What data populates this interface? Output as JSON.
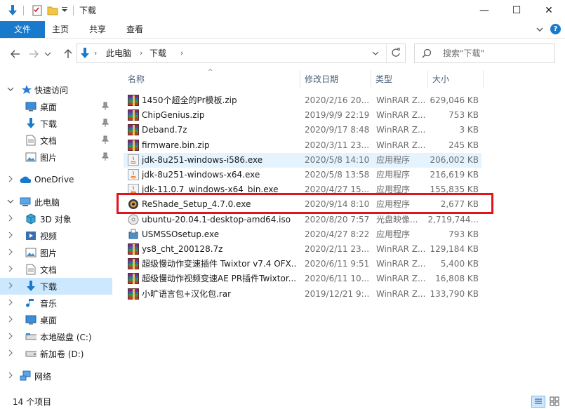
{
  "window": {
    "title": "下载",
    "controls": {
      "minimize": "—",
      "maximize": "☐",
      "close": "✕"
    }
  },
  "ribbon": {
    "tabs": [
      {
        "label": "文件",
        "active": true
      },
      {
        "label": "主页"
      },
      {
        "label": "共享"
      },
      {
        "label": "查看"
      }
    ],
    "expand_icon": "chevron-down-icon",
    "help_icon": "help-icon"
  },
  "address": {
    "segments": [
      "此电脑",
      "下载"
    ],
    "separator": "›"
  },
  "search": {
    "placeholder": "搜索\"下载\""
  },
  "nav": {
    "items": [
      {
        "label": "快速访问",
        "icon": "star-icon",
        "chevron": "⌄",
        "expanded": true
      },
      {
        "label": "桌面",
        "icon": "desktop-icon",
        "pinned": true
      },
      {
        "label": "下载",
        "icon": "download-arrow-icon",
        "pinned": true
      },
      {
        "label": "文档",
        "icon": "document-icon",
        "pinned": true
      },
      {
        "label": "图片",
        "icon": "picture-icon",
        "pinned": true
      },
      {
        "label": "OneDrive",
        "icon": "cloud-icon",
        "chevron": "›"
      },
      {
        "label": "此电脑",
        "icon": "pc-icon",
        "chevron": "⌄",
        "expanded": true
      },
      {
        "label": "3D 对象",
        "icon": "cube-icon",
        "chevron": "›"
      },
      {
        "label": "视频",
        "icon": "video-icon",
        "chevron": "›"
      },
      {
        "label": "图片",
        "icon": "picture-icon",
        "chevron": "›"
      },
      {
        "label": "文档",
        "icon": "document-icon",
        "chevron": "›"
      },
      {
        "label": "下载",
        "icon": "download-arrow-icon",
        "chevron": "›",
        "selected": true
      },
      {
        "label": "音乐",
        "icon": "music-icon",
        "chevron": "›"
      },
      {
        "label": "桌面",
        "icon": "desktop-icon",
        "chevron": "›"
      },
      {
        "label": "本地磁盘 (C:)",
        "icon": "disk-icon",
        "chevron": "›"
      },
      {
        "label": "新加卷 (D:)",
        "icon": "drive-icon",
        "chevron": "›"
      },
      {
        "label": "网络",
        "icon": "network-icon",
        "chevron": "›"
      }
    ]
  },
  "columns": {
    "name": "名称",
    "date": "修改日期",
    "type": "类型",
    "size": "大小"
  },
  "files": [
    {
      "name": "1450个超全的Pr模板.zip",
      "date": "2020/2/16 20...",
      "type": "WinRAR Z...",
      "size": "629,046 KB",
      "icon": "rar"
    },
    {
      "name": "ChipGenius.zip",
      "date": "2019/9/9 22:19",
      "type": "WinRAR Z...",
      "size": "753 KB",
      "icon": "rar"
    },
    {
      "name": "Deband.7z",
      "date": "2020/9/17 8:48",
      "type": "WinRAR Z...",
      "size": "3 KB",
      "icon": "rar"
    },
    {
      "name": "firmware.bin.zip",
      "date": "2020/3/11 23...",
      "type": "WinRAR Z...",
      "size": "245 KB",
      "icon": "rar"
    },
    {
      "name": "jdk-8u251-windows-i586.exe",
      "date": "2020/5/8 14:10",
      "type": "应用程序",
      "size": "206,002 KB",
      "icon": "java",
      "highlight": true
    },
    {
      "name": "jdk-8u251-windows-x64.exe",
      "date": "2020/5/8 13:58",
      "type": "应用程序",
      "size": "216,619 KB",
      "icon": "java"
    },
    {
      "name": "jdk-11.0.7_windows-x64_bin.exe",
      "date": "2020/4/27 15...",
      "type": "应用程序",
      "size": "155,835 KB",
      "icon": "java"
    },
    {
      "name": "ReShade_Setup_4.7.0.exe",
      "date": "2020/9/14 8:10",
      "type": "应用程序",
      "size": "2,677 KB",
      "icon": "reshade"
    },
    {
      "name": "ubuntu-20.04.1-desktop-amd64.iso",
      "date": "2020/8/20 7:57",
      "type": "光盘映像...",
      "size": "2,719,744...",
      "icon": "disc"
    },
    {
      "name": "USMSSOsetup.exe",
      "date": "2020/4/27 8:22",
      "type": "应用程序",
      "size": "793 KB",
      "icon": "setup"
    },
    {
      "name": "ys8_cht_200128.7z",
      "date": "2020/2/11 23...",
      "type": "WinRAR Z...",
      "size": "129,184 KB",
      "icon": "rar"
    },
    {
      "name": "超级慢动作变速插件 Twixtor v7.4 OFX...",
      "date": "2020/6/11 9:51",
      "type": "WinRAR Z...",
      "size": "5,400 KB",
      "icon": "rar"
    },
    {
      "name": "超级慢动作视频变速AE PR插件Twixtor...",
      "date": "2020/6/11 10...",
      "type": "WinRAR Z...",
      "size": "16,808 KB",
      "icon": "rar"
    },
    {
      "name": "小旷语言包+汉化包.rar",
      "date": "2019/12/21 9:...",
      "type": "WinRAR Z...",
      "size": "133,790 KB",
      "icon": "rar"
    }
  ],
  "status": {
    "count": "14 个项目"
  },
  "colors": {
    "accent": "#1979ca",
    "highlight_box": "#e0141e",
    "selected_nav": "#cce8ff"
  }
}
